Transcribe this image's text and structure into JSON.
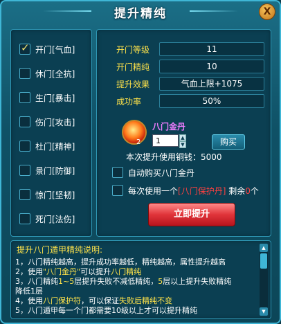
{
  "window": {
    "title": "提升精纯",
    "close_label": "X"
  },
  "gates": [
    {
      "label": "开门[气血]",
      "checked": true
    },
    {
      "label": "休门[全抗]",
      "checked": false
    },
    {
      "label": "生门[暴击]",
      "checked": false
    },
    {
      "label": "伤门[攻击]",
      "checked": false
    },
    {
      "label": "杜门[精神]",
      "checked": false
    },
    {
      "label": "景门[防御]",
      "checked": false
    },
    {
      "label": "惊门[坚韧]",
      "checked": false
    },
    {
      "label": "死门[法伤]",
      "checked": false
    }
  ],
  "stats": [
    {
      "key": "开门等级",
      "value": "11"
    },
    {
      "key": "开门精纯",
      "value": "10"
    },
    {
      "key": "提升效果",
      "value": "气血上限+1075"
    },
    {
      "key": "成功率",
      "value": "50%"
    }
  ],
  "item": {
    "name": "八门金丹",
    "count": "2",
    "quantity": "1",
    "buy_label": "购买",
    "cost_text": "本次提升使用铜钱：5000"
  },
  "options": {
    "auto_buy": {
      "label": "自动购买八门金丹",
      "checked": false
    },
    "protect": {
      "prefix": "每次使用一个",
      "item": "[八门保护丹]",
      "mid": " 剩余",
      "count": "0",
      "suffix": "个",
      "checked": false
    }
  },
  "confirm_label": "立即提升",
  "description": {
    "title": "提升八门遁甲精纯说明:",
    "lines": [
      [
        "1，八门精纯越高，提升成功率越低，精纯越高，属性提升越高"
      ],
      [
        "2，使用",
        "\"八门金丹\"",
        "可以提升",
        "八门精纯"
      ],
      [
        "3，八门精纯",
        "1~5",
        "层提升失败不减低精纯，",
        "5",
        "层以上提升失败精纯"
      ],
      [
        "降低1层"
      ],
      [
        "4，使用",
        "八门保护符",
        "，可以保证",
        "失败后精纯不变"
      ],
      [
        "5，八门遁甲每一个门都需要10级以上才可以提升精纯"
      ]
    ]
  }
}
